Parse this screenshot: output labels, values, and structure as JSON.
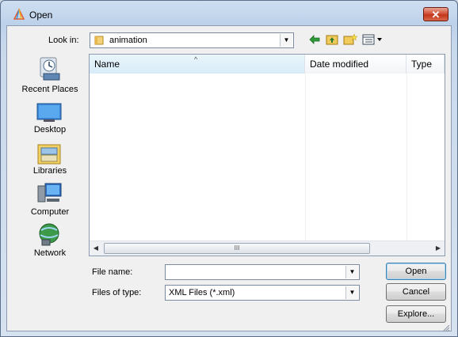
{
  "window": {
    "title": "Open",
    "close_glyph": "✕"
  },
  "lookin": {
    "label": "Look in:",
    "value": "animation"
  },
  "toolbar": {
    "back_icon": "back-arrow-icon",
    "up_icon": "up-folder-icon",
    "new_folder_icon": "new-folder-icon",
    "view_icon": "view-menu-icon"
  },
  "places": [
    {
      "label": "Recent Places",
      "icon": "recent-places-icon"
    },
    {
      "label": "Desktop",
      "icon": "desktop-icon"
    },
    {
      "label": "Libraries",
      "icon": "libraries-icon"
    },
    {
      "label": "Computer",
      "icon": "computer-icon"
    },
    {
      "label": "Network",
      "icon": "network-icon"
    }
  ],
  "list": {
    "columns": [
      "Name",
      "Date modified",
      "Type"
    ],
    "sort_glyph": "^",
    "scroll_grip": "III",
    "rows": []
  },
  "filename": {
    "label": "File name:",
    "value": ""
  },
  "filetype": {
    "label": "Files of type:",
    "value": "XML Files (*.xml)"
  },
  "buttons": {
    "open": "Open",
    "cancel": "Cancel",
    "explore": "Explore..."
  }
}
